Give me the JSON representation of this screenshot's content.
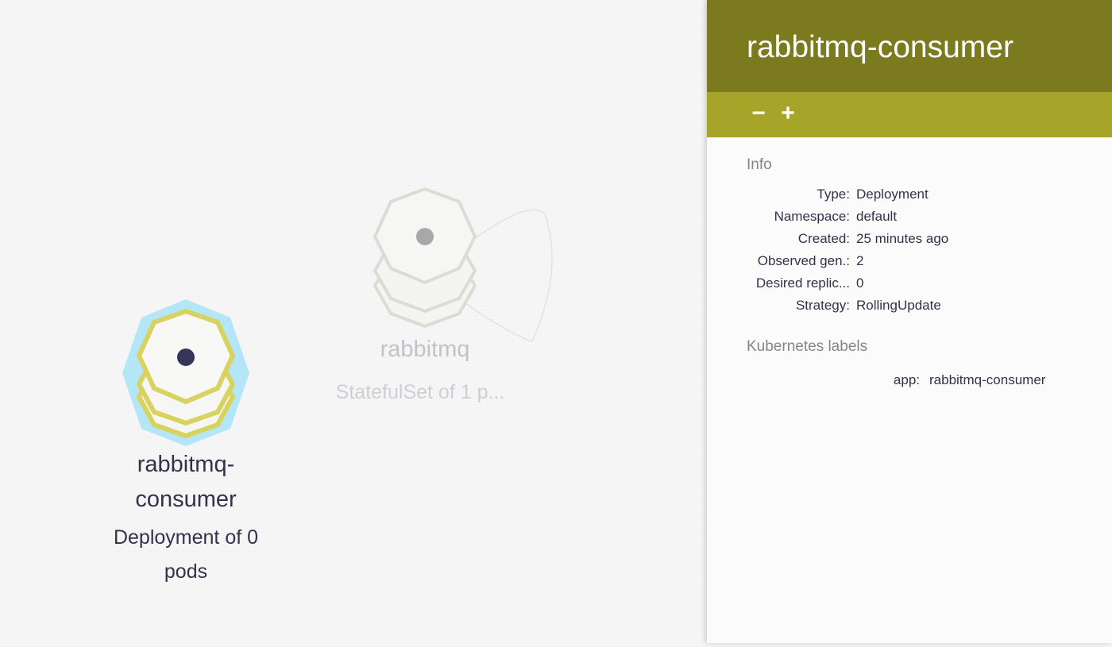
{
  "graph": {
    "nodes": [
      {
        "name": "rabbitmq-consumer",
        "label_line1": "rabbitmq-",
        "label_line2": "consumer",
        "subtitle_line1": "Deployment of 0",
        "subtitle_line2": "pods",
        "selected": true
      },
      {
        "name": "rabbitmq",
        "label": "rabbitmq",
        "subtitle": "StatefulSet of 1 p...",
        "selected": false
      }
    ]
  },
  "colors": {
    "header_bg": "#7b7a1f",
    "toolbar_bg": "#a7a42a",
    "node_highlight": "#b4e6f8",
    "node_outline_selected": "#d8d35e",
    "node_outline_faded": "#dcdcd4",
    "text_dark": "#32324b"
  },
  "details": {
    "title": "rabbitmq-consumer",
    "toolbar": {
      "scale_down": "−",
      "scale_up": "+"
    },
    "info_title": "Info",
    "info": [
      {
        "key": "Type:",
        "value": "Deployment"
      },
      {
        "key": "Namespace:",
        "value": "default"
      },
      {
        "key": "Created:",
        "value": "25 minutes ago"
      },
      {
        "key": "Observed gen.:",
        "value": "2"
      },
      {
        "key": "Desired replic...",
        "value": "0"
      },
      {
        "key": "Strategy:",
        "value": "RollingUpdate"
      }
    ],
    "labels_title": "Kubernetes labels",
    "labels": [
      {
        "key": "app:",
        "value": "rabbitmq-consumer"
      }
    ]
  }
}
